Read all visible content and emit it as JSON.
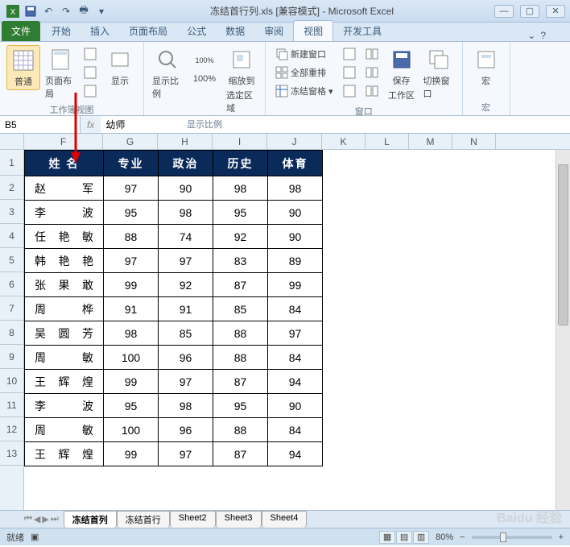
{
  "title": "冻结首行列.xls  [兼容模式] - Microsoft Excel",
  "ribbon_tabs": {
    "file": "文件",
    "items": [
      "开始",
      "插入",
      "页面布局",
      "公式",
      "数据",
      "审阅",
      "视图",
      "开发工具"
    ],
    "active": "视图"
  },
  "ribbon": {
    "group1": {
      "label": "工作簿视图",
      "normal": "普通",
      "page_layout": "页面布局",
      "show": "显示"
    },
    "group2": {
      "label": "显示比例",
      "zoom": "显示比例",
      "hundred": "100%",
      "zoom_selection_1": "缩放到",
      "zoom_selection_2": "选定区域"
    },
    "group3": {
      "label": "窗口",
      "new_window": "新建窗口",
      "arrange_all": "全部重排",
      "freeze_panes": "冻结窗格",
      "save_ws_1": "保存",
      "save_ws_2": "工作区",
      "switch_win": "切换窗口"
    },
    "group4": {
      "label": "宏",
      "macros": "宏"
    }
  },
  "formula": {
    "name_box": "B5",
    "fx": "fx",
    "value": "幼师"
  },
  "columns": [
    "F",
    "G",
    "H",
    "I",
    "J",
    "K",
    "L",
    "M",
    "N"
  ],
  "row_nums": [
    "1",
    "2",
    "3",
    "4",
    "5",
    "6",
    "7",
    "8",
    "9",
    "10",
    "11",
    "12",
    "13"
  ],
  "headers": [
    "姓    名",
    "专业",
    "政治",
    "历史",
    "体育"
  ],
  "rows": [
    {
      "name": "赵    军",
      "vals": [
        "97",
        "90",
        "98",
        "98"
      ]
    },
    {
      "name": "李    波",
      "vals": [
        "95",
        "98",
        "95",
        "90"
      ]
    },
    {
      "name": "任 艳 敏",
      "vals": [
        "88",
        "74",
        "92",
        "90"
      ]
    },
    {
      "name": "韩 艳 艳",
      "vals": [
        "97",
        "97",
        "83",
        "89"
      ]
    },
    {
      "name": "张 果 敢",
      "vals": [
        "99",
        "92",
        "87",
        "99"
      ]
    },
    {
      "name": "周    桦",
      "vals": [
        "91",
        "91",
        "85",
        "84"
      ]
    },
    {
      "name": "吴 圆 芳",
      "vals": [
        "98",
        "85",
        "88",
        "97"
      ]
    },
    {
      "name": "周    敏",
      "vals": [
        "100",
        "96",
        "88",
        "84"
      ]
    },
    {
      "name": "王 辉 煌",
      "vals": [
        "99",
        "97",
        "87",
        "94"
      ]
    },
    {
      "name": "李    波",
      "vals": [
        "95",
        "98",
        "95",
        "90"
      ]
    },
    {
      "name": "周    敏",
      "vals": [
        "100",
        "96",
        "88",
        "84"
      ]
    },
    {
      "name": "王 辉 煌",
      "vals": [
        "99",
        "97",
        "87",
        "94"
      ]
    }
  ],
  "sheets": [
    "冻结首列",
    "冻结首行",
    "Sheet2",
    "Sheet3",
    "Sheet4"
  ],
  "active_sheet": "冻结首列",
  "status": {
    "ready": "就绪",
    "zoom": "80%"
  },
  "watermark": "Baidu 经验"
}
